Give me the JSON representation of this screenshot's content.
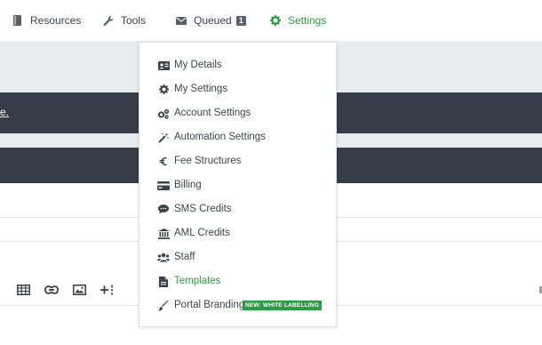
{
  "nav": {
    "resources_label": "Resources",
    "tools_label": "Tools",
    "queued_label": "Queued",
    "queued_count": "1",
    "settings_label": "Settings"
  },
  "banner": {
    "fragment_text": "e."
  },
  "settings_menu": {
    "items": [
      {
        "label": "My Details",
        "icon": "id-card-icon"
      },
      {
        "label": "My Settings",
        "icon": "gear-icon"
      },
      {
        "label": "Account Settings",
        "icon": "gears-icon"
      },
      {
        "label": "Automation Settings",
        "icon": "magic-wand-icon"
      },
      {
        "label": "Fee Structures",
        "icon": "euro-icon"
      },
      {
        "label": "Billing",
        "icon": "credit-card-icon"
      },
      {
        "label": "SMS Credits",
        "icon": "comment-icon"
      },
      {
        "label": "AML Credits",
        "icon": "bank-icon"
      },
      {
        "label": "Staff",
        "icon": "users-icon"
      },
      {
        "label": "Templates",
        "icon": "file-icon",
        "active": true
      },
      {
        "label": "Portal Branding",
        "icon": "paint-brush-icon",
        "badge": "NEW: WHITE LABELLING"
      }
    ]
  },
  "editor_toolbar": {
    "tools": [
      "table-icon",
      "link-icon",
      "image-icon",
      "insert-icon"
    ]
  },
  "colors": {
    "accent_green": "#2e9b3f",
    "dark_bar": "#353e48",
    "light_band": "#e9ecef"
  }
}
